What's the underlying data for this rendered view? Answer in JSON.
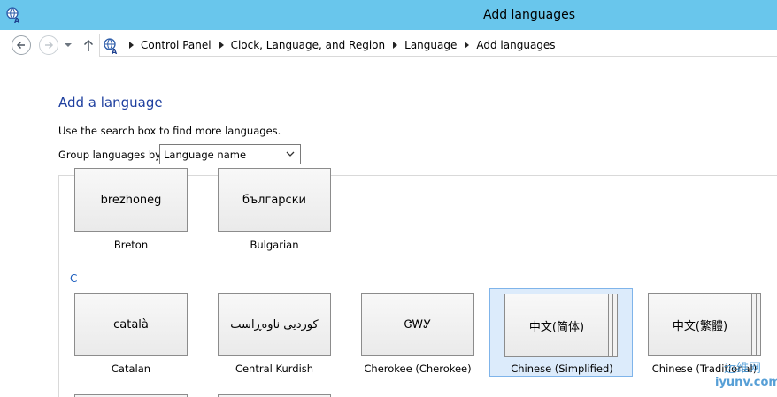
{
  "window": {
    "title": "Add languages",
    "app_icon": "language-globe-icon"
  },
  "navigation": {
    "back_icon": "back-arrow-icon",
    "forward_icon": "forward-arrow-icon",
    "up_icon": "up-arrow-icon",
    "breadcrumbs": [
      "Control Panel",
      "Clock, Language, and Region",
      "Language",
      "Add languages"
    ]
  },
  "main": {
    "heading": "Add a language",
    "hint": "Use the search box to find more languages.",
    "group_by_label": "Group languages by:",
    "group_by_value": "Language name",
    "section_letter": "C"
  },
  "languages": [
    {
      "native": "brezhoneg",
      "name": "Breton"
    },
    {
      "native": "български",
      "name": "Bulgarian"
    },
    {
      "native": "català",
      "name": "Catalan"
    },
    {
      "native": "کوردیی ناوەڕاست",
      "name": "Central Kurdish"
    },
    {
      "native": "ᏣᎳᎩ",
      "name": "Cherokee (Cherokee)"
    },
    {
      "native": "中文(简体)",
      "name": "Chinese (Simplified)"
    },
    {
      "native": "中文(繁體)",
      "name": "Chinese (Traditional)"
    }
  ],
  "watermark": {
    "line1": "运维网",
    "line2": "iyunv.com"
  },
  "colors": {
    "titlebar": "#69c6ec",
    "heading": "#1e3f9f",
    "selection": "#dcebfb",
    "selection_border": "#7fb4ea"
  }
}
